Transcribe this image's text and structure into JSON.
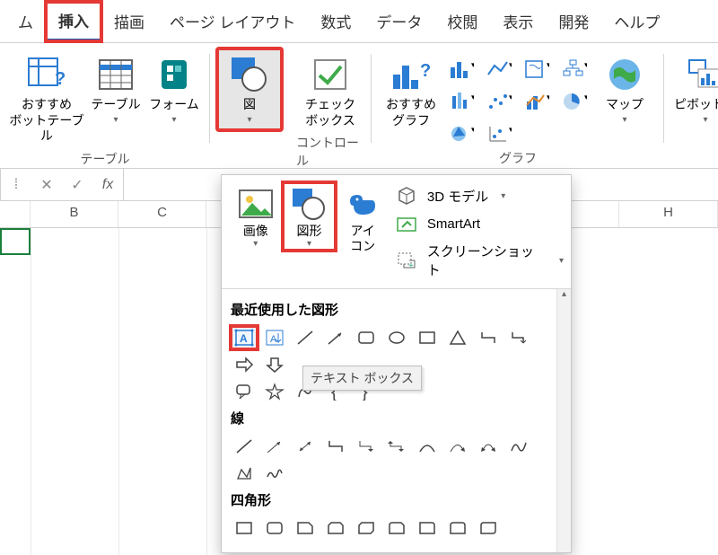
{
  "tabs": {
    "home_fragment": "ム",
    "insert": "挿入",
    "draw": "描画",
    "page_layout": "ページ レイアウト",
    "formulas": "数式",
    "data": "データ",
    "review": "校閲",
    "view": "表示",
    "developer": "開発",
    "help": "ヘルプ"
  },
  "ribbon": {
    "tables": {
      "recommended_pivot_prefix": "おすすめ",
      "recommended_pivot_suffix": "ボットテーブル",
      "table": "テーブル",
      "form": "フォーム",
      "group_label": "テーブル"
    },
    "illustrations": {
      "button": "図"
    },
    "controls": {
      "checkbox_line1": "チェック",
      "checkbox_line2": "ボックス",
      "group_label": "コントロール"
    },
    "charts": {
      "recommended_line1": "おすすめ",
      "recommended_line2": "グラフ",
      "map": "マップ",
      "pivot_chart": "ピボットグ",
      "group_label": "グラフ"
    }
  },
  "illus_panel": {
    "images": "画像",
    "shapes": "図形",
    "icons_line1": "アイ",
    "icons_line2": "コン",
    "model3d": "3D モデル",
    "smartart": "SmartArt",
    "screenshot": "スクリーンショット"
  },
  "shapes_panel": {
    "recent": "最近使用した図形",
    "lines": "線",
    "rectangles": "四角形",
    "tooltip": "テキスト ボックス"
  },
  "formula_bar": {
    "fx": "fx"
  },
  "columns": {
    "b": "B",
    "c": "C",
    "h": "H"
  }
}
